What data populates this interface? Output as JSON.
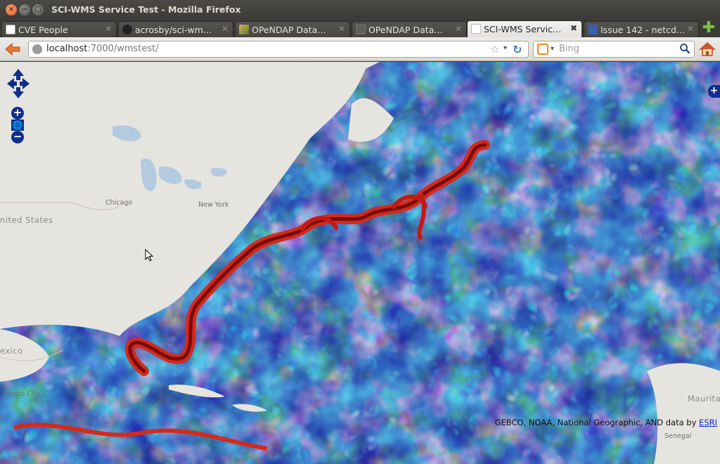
{
  "window": {
    "title": "SCI-WMS Service Test - Mozilla Firefox",
    "close_glyph": "×",
    "minimize_glyph": "−",
    "maximize_glyph": "□"
  },
  "tabs": [
    {
      "label": "CVE People",
      "close": "✕",
      "icon": "page-icon"
    },
    {
      "label": "acrosby/sci-wm…",
      "close": "✕",
      "icon": "github-icon"
    },
    {
      "label": "OPeNDAP Data…",
      "close": "✕",
      "icon": "opendap-icon"
    },
    {
      "label": "OPeNDAP Data…",
      "close": "✕",
      "icon": "blank-page-icon"
    },
    {
      "label": "SCI-WMS Servic…",
      "close": "✖",
      "icon": "loading-icon",
      "active": true
    },
    {
      "label": "Issue 142 - netcd…",
      "close": "✕",
      "icon": "issue-tracker-icon"
    }
  ],
  "new_tab_glyph": "✚",
  "navbar": {
    "url_host": "localhost",
    "url_path": ":7000/wmstest/",
    "bookmark_glyph": "☆",
    "dropdown_glyph": "▾",
    "reload_glyph": "↻",
    "search_placeholder": "Bing",
    "search_arrow": "▾"
  },
  "map": {
    "labels": {
      "united_states": "nited States",
      "chicago": "Chicago",
      "new_york": "New York",
      "mexico": "exico",
      "mexico_city": "Mexico City",
      "mauritania": "Maurita",
      "senegal": "Senegal"
    },
    "controls": {
      "zoom_in": "+",
      "zoom_world": "🌐",
      "zoom_out": "−",
      "layer_switcher": "+"
    },
    "attribution_text": "GEBCO, NOAA, National Geographic, AND data by ",
    "attribution_link": "ESRI"
  },
  "colors": {
    "ocean_low": "#0b0b78",
    "ocean_mid": "#1e3cf0",
    "cyan": "#27d8f0",
    "yellow": "#f2e83a",
    "red": "#d42a1c",
    "dark_red": "#7a0c0c",
    "land": "#e6e4de",
    "water_lakes": "#b3cbe0"
  }
}
